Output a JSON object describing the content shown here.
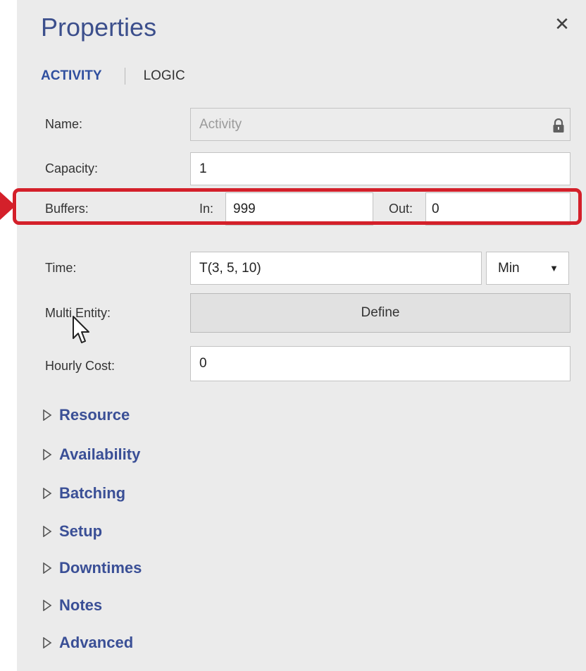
{
  "panel": {
    "title": "Properties",
    "close_glyph": "✕",
    "tabs": [
      {
        "label": "ACTIVITY",
        "active": true
      },
      {
        "label": "LOGIC",
        "active": false
      }
    ]
  },
  "fields": {
    "name": {
      "label": "Name:",
      "value": "Activity",
      "locked": true
    },
    "capacity": {
      "label": "Capacity:",
      "value": "1"
    },
    "buffers": {
      "label": "Buffers:",
      "in_label": "In:",
      "in_value": "999",
      "out_label": "Out:",
      "out_value": "0"
    },
    "time": {
      "label": "Time:",
      "value": "T(3, 5, 10)",
      "unit": "Min"
    },
    "multi_entity": {
      "label": "Multi Entity:",
      "button": "Define"
    },
    "hourly_cost": {
      "label": "Hourly Cost:",
      "value": "0"
    }
  },
  "sections": [
    "Resource",
    "Availability",
    "Batching",
    "Setup",
    "Downtimes",
    "Notes",
    "Advanced"
  ],
  "colors": {
    "accent": "#3a4f96",
    "highlight": "#d4202a",
    "panel_bg": "#ebebeb"
  },
  "icons": [
    "close-icon",
    "lock-icon",
    "dropdown-icon",
    "expand-triangle-icon",
    "mouse-cursor-icon"
  ]
}
